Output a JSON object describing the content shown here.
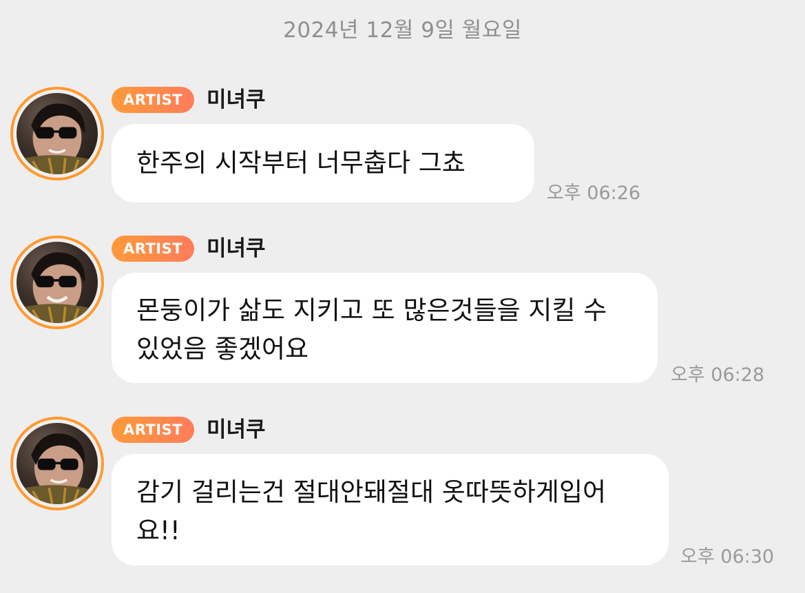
{
  "date_separator": "2024년 12월 9일 월요일",
  "messages": [
    {
      "badge": "ARTIST",
      "sender": "미녀쿠",
      "text": "한주의 시작부터 너무춥다 그쵸",
      "time": "오후 06:26"
    },
    {
      "badge": "ARTIST",
      "sender": "미녀쿠",
      "text": "몬둥이가 삶도 지키고 또 많은것들을 지킬 수 있었음 좋겠어요",
      "time": "오후 06:28"
    },
    {
      "badge": "ARTIST",
      "sender": "미녀쿠",
      "text": "감기 걸리는건 절대안돼절대 옷따뜻하게입어요!!",
      "time": "오후 06:30"
    }
  ],
  "colors": {
    "background": "#efeeef",
    "bubble": "#ffffff",
    "badge_start": "#ff9a3a",
    "badge_end": "#ff7c5a",
    "avatar_ring": "#ff9a2e",
    "timestamp": "#9a9a9a"
  }
}
